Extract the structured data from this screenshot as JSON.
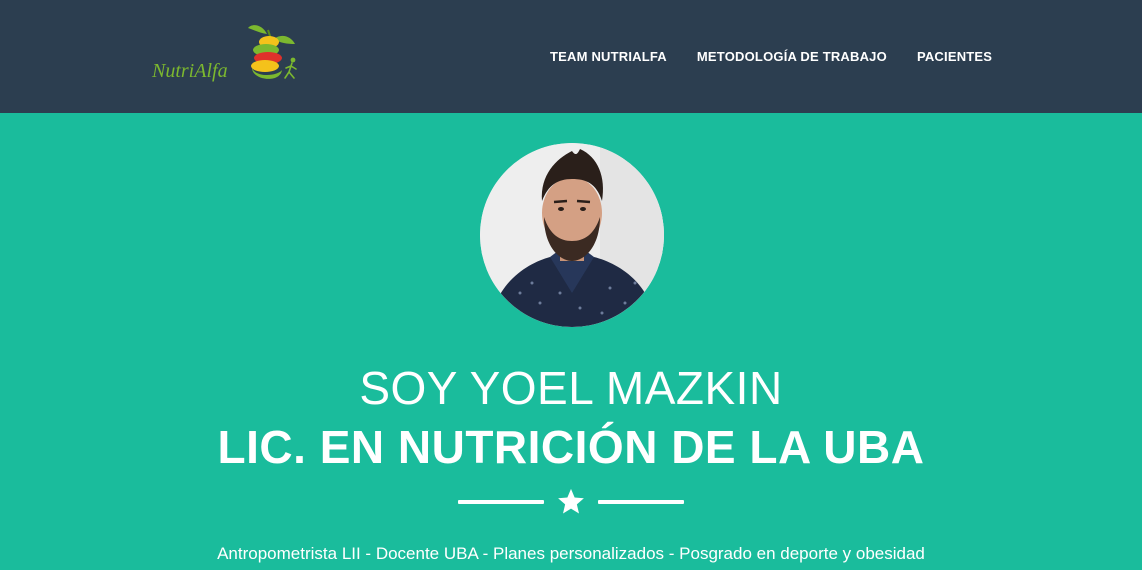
{
  "brand": {
    "logo_text": "NutriAlfa"
  },
  "nav": {
    "items": [
      {
        "label": "TEAM NUTRIALFA"
      },
      {
        "label": "METODOLOGÍA DE TRABAJO"
      },
      {
        "label": "PACIENTES"
      }
    ]
  },
  "masthead": {
    "name": "SOY YOEL MAZKIN",
    "title": "LIC. EN NUTRICIÓN DE LA UBA",
    "divider_icon": "star-icon",
    "tagline": "Antropometrista LII - Docente UBA - Planes personalizados - Posgrado en deporte y obesidad"
  },
  "colors": {
    "navbar": "#2c3e50",
    "masthead": "#1abc9c",
    "logo_green": "#7cb82f",
    "logo_red": "#e0312b",
    "logo_yellow": "#f4c21b"
  }
}
